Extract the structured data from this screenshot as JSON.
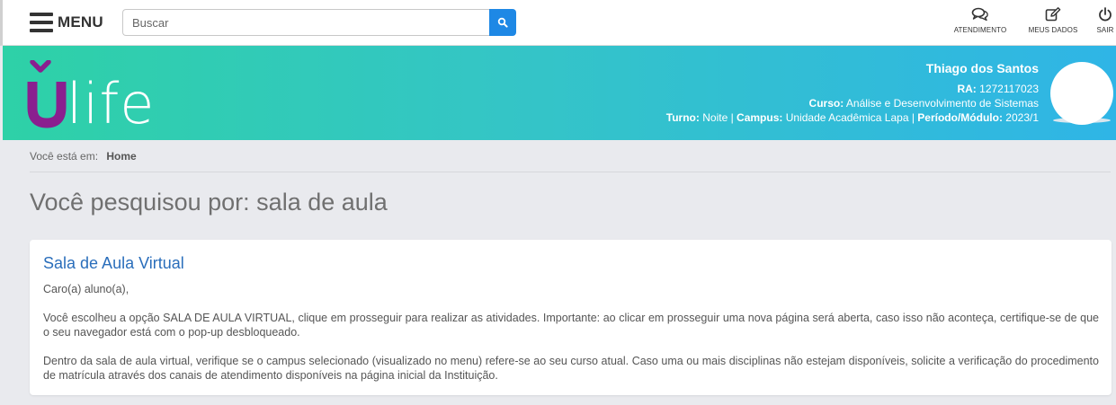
{
  "topbar": {
    "menu_label": "MENU",
    "search_placeholder": "Buscar",
    "actions": [
      {
        "label": "ATENDIMENTO",
        "icon": "chat-icon"
      },
      {
        "label": "MEUS DADOS",
        "icon": "edit-icon"
      },
      {
        "label": "SAIR",
        "icon": "power-icon"
      }
    ]
  },
  "banner": {
    "logo_text": "ulife",
    "logo_colors": {
      "u": "#8a1f8f",
      "life": "#ffffff"
    },
    "user": {
      "name": "Thiago dos Santos",
      "ra_label": "RA:",
      "ra_value": "1272117023",
      "curso_label": "Curso:",
      "curso_value": "Análise e Desenvolvimento de Sistemas",
      "turno_label": "Turno:",
      "turno_value": "Noite",
      "campus_label": "Campus:",
      "campus_value": "Unidade Acadêmica Lapa",
      "periodo_label": "Período/Módulo:",
      "periodo_value": "2023/1"
    }
  },
  "breadcrumb": {
    "prefix": "Você está em:",
    "current": "Home"
  },
  "page_title": "Você pesquisou por: sala de aula",
  "result": {
    "title": "Sala de Aula Virtual",
    "paragraphs": [
      "Caro(a) aluno(a),",
      "Você escolheu a opção SALA DE AULA VIRTUAL, clique em prosseguir para realizar as atividades. Importante: ao clicar em prosseguir uma nova página será aberta, caso isso não aconteça, certifique-se de que o seu navegador está com o pop-up desbloqueado.",
      "Dentro da sala de aula virtual, verifique se o campus selecionado (visualizado no menu) refere-se ao seu curso atual. Caso uma ou mais disciplinas não estejam disponíveis, solicite a verificação do procedimento de matrícula através dos canais de atendimento disponíveis na página inicial da Instituição."
    ]
  },
  "colors": {
    "search_button": "#1e88e5",
    "link": "#2a6ebb",
    "banner_gradient_start": "#2ed1a7",
    "banner_gradient_end": "#2fb5e6"
  }
}
